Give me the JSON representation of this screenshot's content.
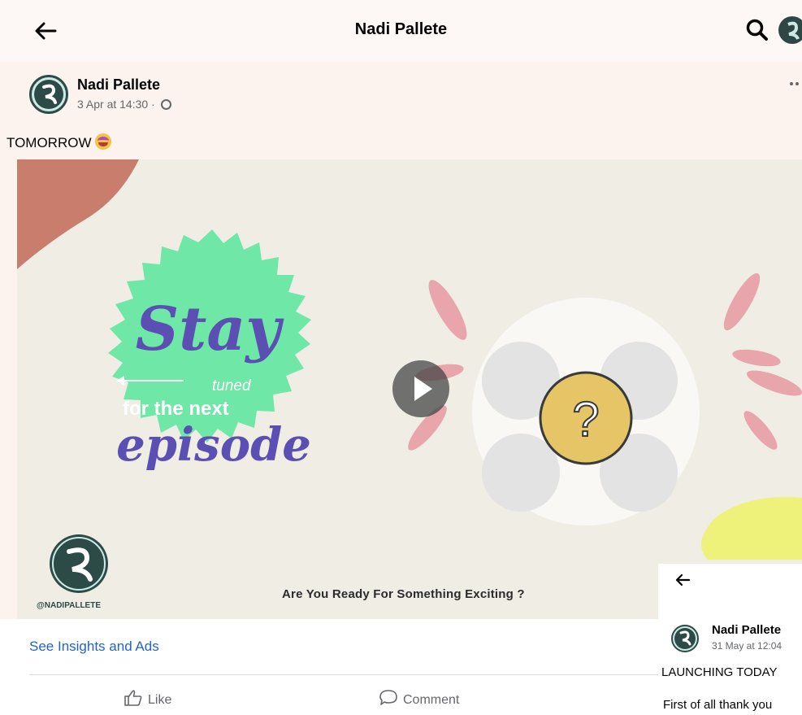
{
  "header": {
    "title": "Nadi Pallete",
    "back_icon": "arrow-left-icon",
    "search_icon": "search-icon"
  },
  "post": {
    "author": "Nadi Pallete",
    "timestamp": "3 Apr at 14:30 · ",
    "text": "TOMORROW ",
    "video": {
      "headline": "Stay",
      "tuned": "tuned",
      "subline": "for the next",
      "episode": "episode",
      "question": "?",
      "handle": "@NADIPALLETE",
      "caption": "Are You Ready For Something Exciting ?"
    },
    "insights_link": "See Insights and Ads",
    "actions": {
      "like": "Like",
      "comment": "Comment"
    }
  },
  "popup": {
    "author": "Nadi Pallete",
    "timestamp": "31 May at 12:04",
    "text": "LAUNCHING TODAY",
    "cut_text": "First of all thank you"
  },
  "colors": {
    "accent_green": "#6ee7a7",
    "purple": "#5b4fb3",
    "brand_teal": "#2c4a46",
    "link_blue": "#2163c8",
    "blob_red": "#c97d6c",
    "blob_yellow": "#eef27b"
  }
}
